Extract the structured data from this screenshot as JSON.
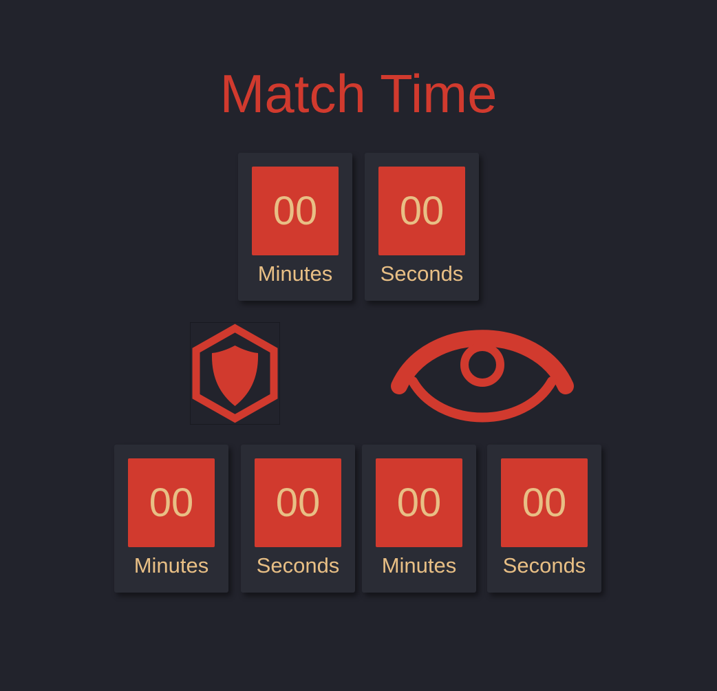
{
  "title": "Match Time",
  "colors": {
    "background": "#22232c",
    "tile": "#2a2c35",
    "accent": "#d13a2e",
    "digit_text": "#e8bf85"
  },
  "main_timer": {
    "minutes": {
      "value": "00",
      "label": "Minutes"
    },
    "seconds": {
      "value": "00",
      "label": "Seconds"
    }
  },
  "defense_timer": {
    "icon": "hexagon-shield-icon",
    "minutes": {
      "value": "00",
      "label": "Minutes"
    },
    "seconds": {
      "value": "00",
      "label": "Seconds"
    }
  },
  "vision_timer": {
    "icon": "eye-icon",
    "minutes": {
      "value": "00",
      "label": "Minutes"
    },
    "seconds": {
      "value": "00",
      "label": "Seconds"
    }
  }
}
